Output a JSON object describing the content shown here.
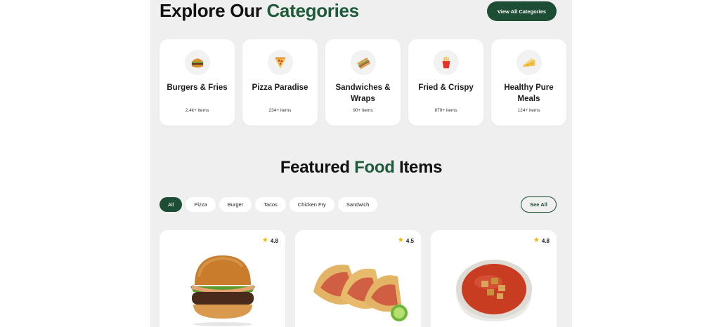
{
  "categories_section": {
    "title_prefix": "Explore Our",
    "title_accent": "Categories",
    "view_all_label": "View All Categories",
    "items": [
      {
        "name": "Burgers & Fries",
        "count": "2.4k+ items",
        "icon": "burger-icon"
      },
      {
        "name": "Pizza Paradise",
        "count": "234+ items",
        "icon": "pizza-icon"
      },
      {
        "name": "Sandwiches & Wraps",
        "count": "90+ items",
        "icon": "sandwich-icon"
      },
      {
        "name": "Fried & Crispy",
        "count": "870+ items",
        "icon": "fries-icon"
      },
      {
        "name": "Healthy Pure Meals",
        "count": "124+ items",
        "icon": "cheese-icon"
      }
    ]
  },
  "featured_section": {
    "title_prefix": "Featured",
    "title_accent": "Food",
    "title_suffix": "Items",
    "filters": [
      "All",
      "Pizza",
      "Burger",
      "Tacos",
      "Chicken Fry",
      "Sandwich"
    ],
    "active_filter": "All",
    "see_all_label": "See All",
    "items": [
      {
        "rating": "4.8",
        "image": "burger-photo"
      },
      {
        "rating": "4.5",
        "image": "tacos-photo"
      },
      {
        "rating": "4.8",
        "image": "tomato-soup-photo"
      }
    ]
  },
  "colors": {
    "accent": "#1e5a3a",
    "button_bg": "#1e4d35",
    "panel_bg": "#efefef",
    "star": "#f4b400"
  }
}
